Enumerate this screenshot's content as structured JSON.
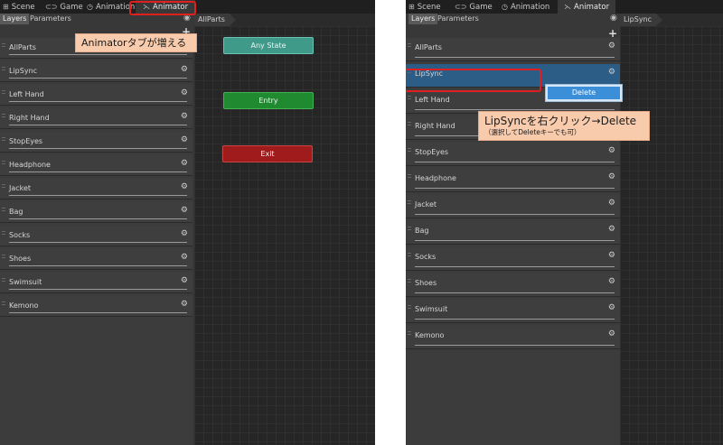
{
  "tabs": [
    {
      "label": "Scene",
      "icon": "grid-icon"
    },
    {
      "label": "Game",
      "icon": "gamepad-icon"
    },
    {
      "label": "Animation",
      "icon": "clock-icon"
    },
    {
      "label": "Animator",
      "icon": "animator-icon"
    }
  ],
  "subtabs": {
    "layers": "Layers",
    "parameters": "Parameters"
  },
  "left": {
    "breadcrumb": "AllParts",
    "layers": [
      "AllParts",
      "LipSync",
      "Left Hand",
      "Right Hand",
      "StopEyes",
      "Headphone",
      "Jacket",
      "Bag",
      "Socks",
      "Shoes",
      "Swimsuit",
      "Kemono"
    ],
    "states": {
      "any": "Any State",
      "entry": "Entry",
      "exit": "Exit"
    },
    "callout": "Animatorタブが増える"
  },
  "right": {
    "breadcrumb": "LipSync",
    "layers": [
      "AllParts",
      "LipSync",
      "Left Hand",
      "Right Hand",
      "StopEyes",
      "Headphone",
      "Jacket",
      "Bag",
      "Socks",
      "Shoes",
      "Swimsuit",
      "Kemono"
    ],
    "selected": "LipSync",
    "context_menu": {
      "delete": "Delete"
    },
    "callout": {
      "main": "LipSyncを右クリック→Delete",
      "sub": "（選択してDeleteキーでも可）"
    }
  },
  "colors": {
    "any_state": "#3f9a8a",
    "entry": "#1f8a30",
    "exit": "#a01c1c",
    "highlight": "#e02020",
    "callout": "#f8cbad",
    "selected": "#2c5d87"
  }
}
